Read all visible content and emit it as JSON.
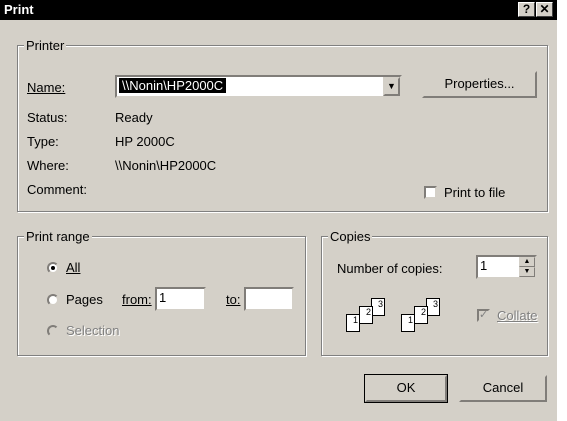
{
  "window": {
    "title": "Print",
    "help_label": "?",
    "close_label": "✕"
  },
  "printer": {
    "legend": "Printer",
    "name_label": "Name:",
    "name_value": "\\\\Nonin\\HP2000C",
    "properties_label": "Properties...",
    "status_label": "Status:",
    "status_value": "Ready",
    "type_label": "Type:",
    "type_value": "HP 2000C",
    "where_label": "Where:",
    "where_value": "\\\\Nonin\\HP2000C",
    "comment_label": "Comment:",
    "print_to_file_label": "Print to file"
  },
  "print_range": {
    "legend": "Print range",
    "all_label": "All",
    "pages_label": "Pages",
    "from_label": "from:",
    "from_value": "1",
    "to_label": "to:",
    "to_value": "",
    "selection_label": "Selection",
    "selected": "All"
  },
  "copies": {
    "legend": "Copies",
    "number_label": "Number of copies:",
    "number_value": "1",
    "collate_label": "Collate",
    "collate_checked": true,
    "page_numbers": [
      "1",
      "2",
      "3"
    ]
  },
  "buttons": {
    "ok_label": "OK",
    "cancel_label": "Cancel"
  },
  "icons": {
    "dropdown": "chevron-down-icon",
    "spin_up": "arrow-up-icon",
    "spin_down": "arrow-down-icon"
  }
}
